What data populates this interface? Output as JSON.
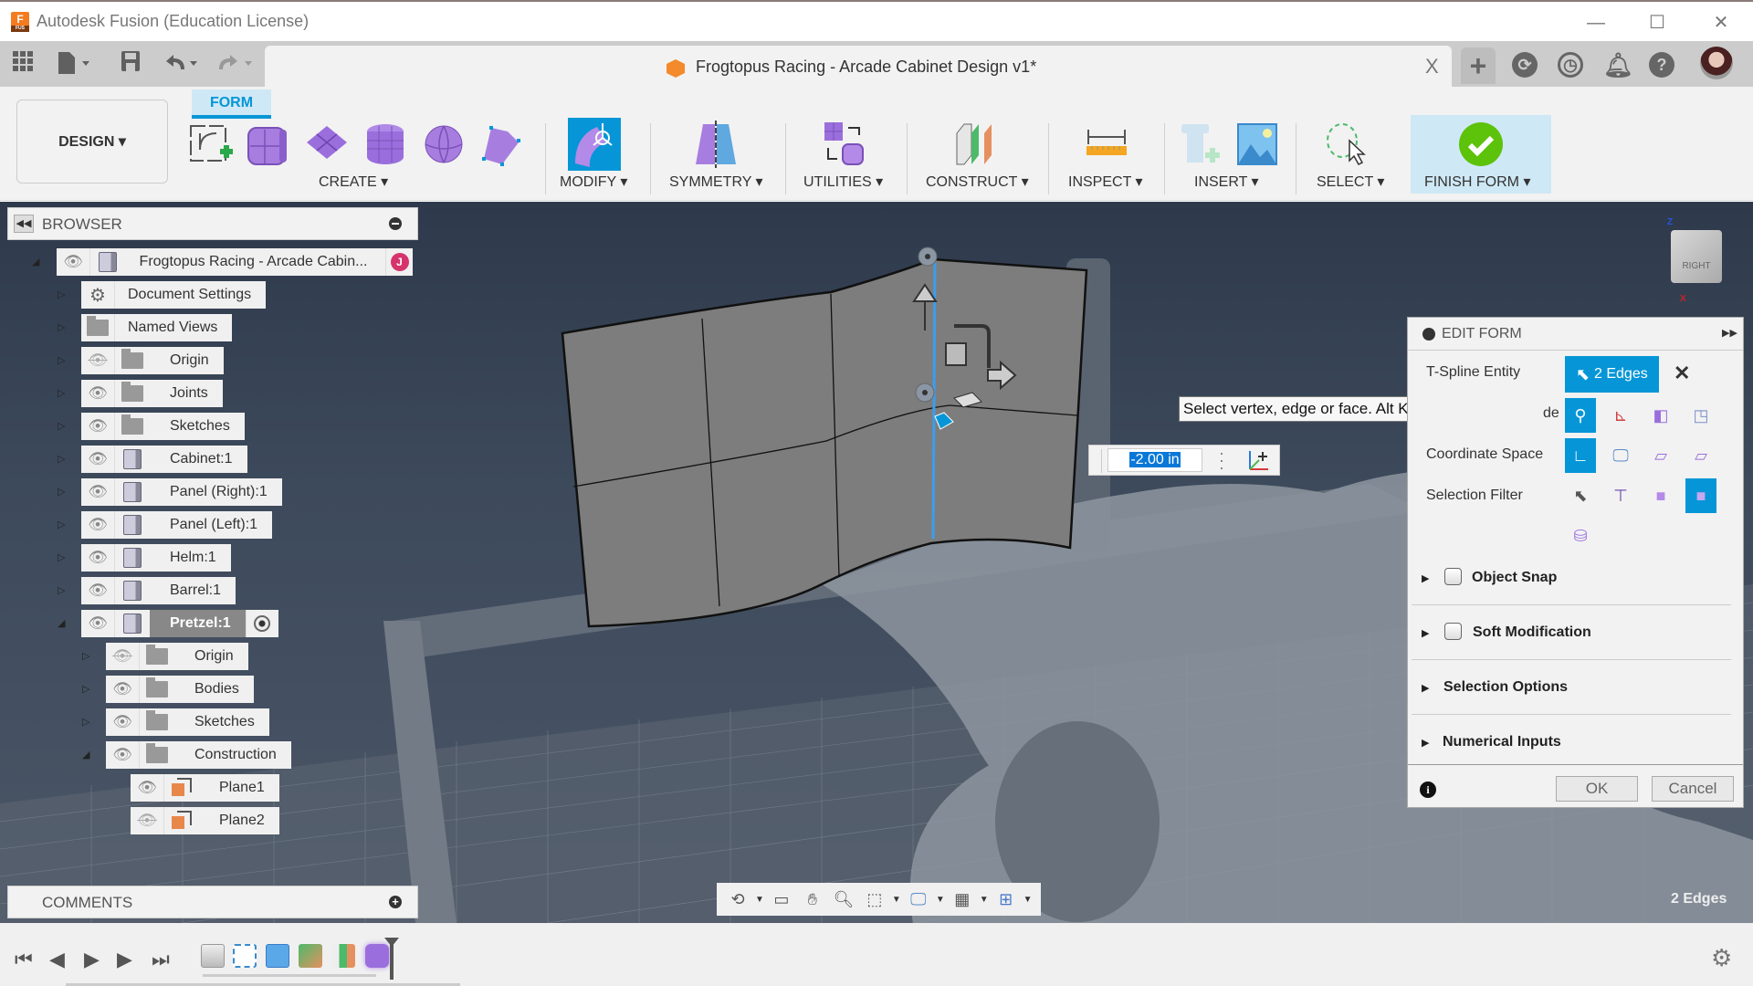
{
  "window": {
    "app_title": "Autodesk Fusion (Education License)",
    "controls": {
      "minimize": "—",
      "maximize": "☐",
      "close": "✕"
    }
  },
  "qat": {
    "icons": [
      "grid-menu-icon",
      "file-icon",
      "save-icon",
      "undo-icon",
      "redo-icon"
    ],
    "document_tab": "Frogtopus Racing - Arcade Cabinet Design v1*",
    "tab_close": "X",
    "new_tab": "+",
    "right_icons": [
      "extensions-icon",
      "job-status-icon",
      "notifications-icon",
      "help-icon"
    ]
  },
  "ribbon": {
    "workspace": "DESIGN ▾",
    "active_tab": "FORM",
    "groups": [
      {
        "label": "CREATE ▾"
      },
      {
        "label": "MODIFY ▾"
      },
      {
        "label": "SYMMETRY ▾"
      },
      {
        "label": "UTILITIES ▾"
      },
      {
        "label": "CONSTRUCT ▾"
      },
      {
        "label": "INSPECT ▾"
      },
      {
        "label": "INSERT ▾"
      },
      {
        "label": "SELECT ▾"
      },
      {
        "label": "FINISH FORM ▾"
      }
    ]
  },
  "browser": {
    "title": "BROWSER",
    "root": {
      "label": "Frogtopus Racing - Arcade Cabin...",
      "badge": "J"
    },
    "items": [
      {
        "label": "Document Settings",
        "visible": null,
        "icon": "gear"
      },
      {
        "label": "Named Views",
        "visible": null,
        "icon": "folder"
      },
      {
        "label": "Origin",
        "visible": false,
        "icon": "folder"
      },
      {
        "label": "Joints",
        "visible": true,
        "icon": "folder"
      },
      {
        "label": "Sketches",
        "visible": true,
        "icon": "folder"
      },
      {
        "label": "Cabinet:1",
        "visible": true,
        "icon": "component"
      },
      {
        "label": "Panel (Right):1",
        "visible": true,
        "icon": "body"
      },
      {
        "label": "Panel (Left):1",
        "visible": true,
        "icon": "body"
      },
      {
        "label": "Helm:1",
        "visible": true,
        "icon": "body"
      },
      {
        "label": "Barrel:1",
        "visible": true,
        "icon": "body"
      },
      {
        "label": "Pretzel:1",
        "visible": true,
        "icon": "body",
        "active": true
      }
    ],
    "pretzel_children": [
      {
        "label": "Origin",
        "visible": false
      },
      {
        "label": "Bodies",
        "visible": true
      },
      {
        "label": "Sketches",
        "visible": true
      },
      {
        "label": "Construction",
        "visible": true
      }
    ],
    "construction_children": [
      {
        "label": "Plane1",
        "visible": true
      },
      {
        "label": "Plane2",
        "visible": false
      }
    ]
  },
  "comments": {
    "title": "COMMENTS"
  },
  "viewcube": {
    "face": "RIGHT",
    "axes": [
      "Z",
      "X"
    ]
  },
  "tooltip": "Select vertex, edge or face. Alt Key to extrude",
  "value_input": {
    "value": "-2.00 in"
  },
  "edit_form": {
    "title": "EDIT FORM",
    "tspline_entity_label": "T-Spline Entity",
    "tspline_entity_value": "2 Edges",
    "transform_mode_label": "de",
    "coordinate_space_label": "Coordinate Space",
    "selection_filter_label": "Selection Filter",
    "sections": [
      {
        "label": "Object Snap",
        "checkbox": true,
        "checked": false
      },
      {
        "label": "Soft Modification",
        "checkbox": true,
        "checked": false
      },
      {
        "label": "Selection Options",
        "checkbox": false
      },
      {
        "label": "Numerical Inputs",
        "checkbox": false
      }
    ],
    "ok": "OK",
    "cancel": "Cancel"
  },
  "status": {
    "selection": "2 Edges"
  },
  "navbar": {
    "icons": [
      "orbit-icon",
      "look-at-icon",
      "pan-icon",
      "zoom-icon",
      "zoom-window-icon",
      "display-settings-icon",
      "grid-icon",
      "viewports-icon"
    ]
  },
  "timeline": {
    "controls": [
      "first",
      "previous",
      "play",
      "next",
      "last"
    ],
    "features": [
      "component",
      "sketch",
      "extrude",
      "pipe",
      "plane",
      "form"
    ]
  }
}
